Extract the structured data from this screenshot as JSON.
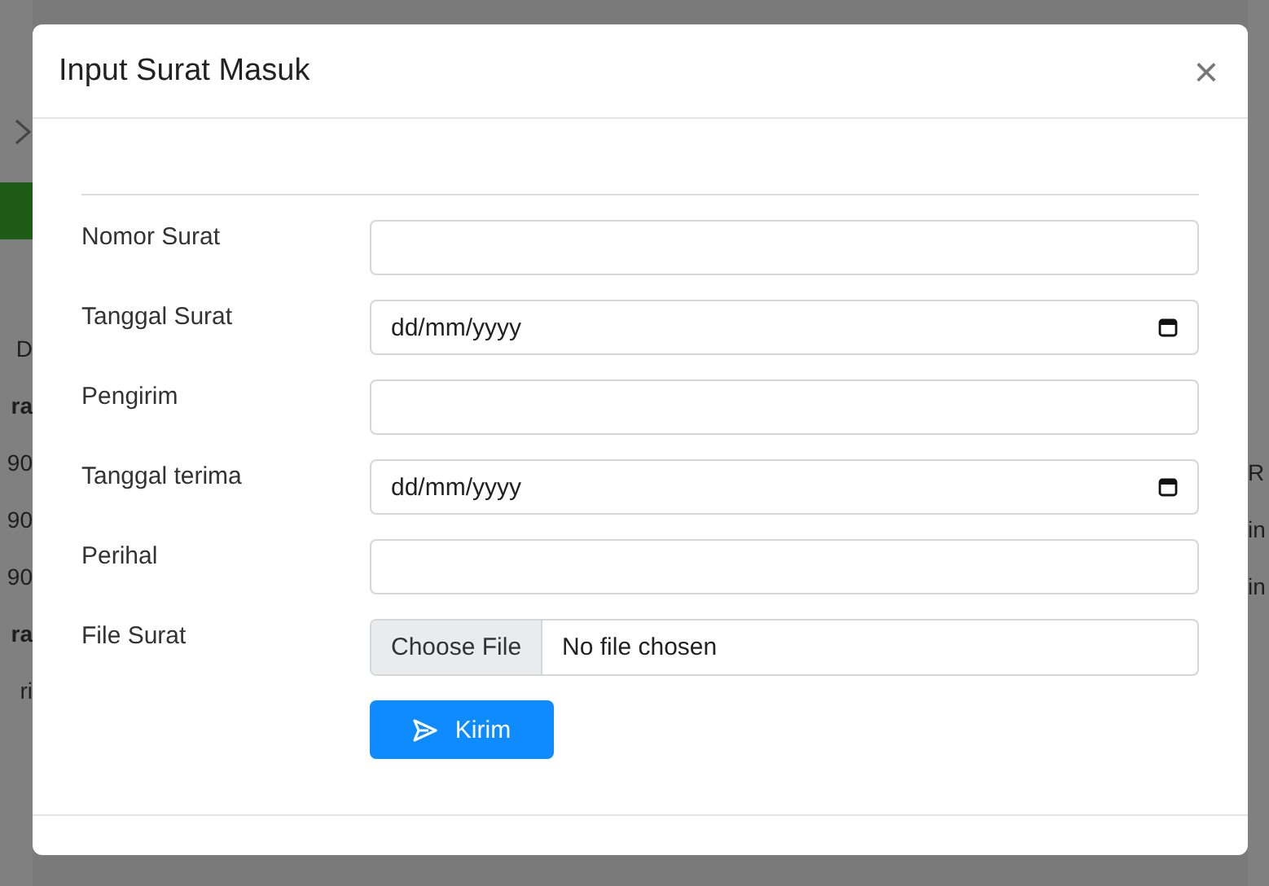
{
  "backdrop": {
    "left_fragments": [
      {
        "text": "D",
        "bold": false
      },
      {
        "text": "ra",
        "bold": true
      },
      {
        "text": "90",
        "bold": false
      },
      {
        "text": "90",
        "bold": false
      },
      {
        "text": "90",
        "bold": false
      },
      {
        "text": "ra",
        "bold": true
      },
      {
        "text": "ri",
        "bold": false
      }
    ],
    "right_fragments": [
      {
        "text": "R"
      },
      {
        "text": "in"
      },
      {
        "text": "in"
      }
    ]
  },
  "modal": {
    "title": "Input Surat Masuk",
    "close": "×",
    "fields": [
      {
        "label": "Nomor Surat",
        "kind": "text"
      },
      {
        "label": "Tanggal Surat",
        "kind": "date",
        "placeholder": "dd/mm/yyyy"
      },
      {
        "label": "Pengirim",
        "kind": "text"
      },
      {
        "label": "Tanggal terima",
        "kind": "date",
        "placeholder": "dd/mm/yyyy"
      },
      {
        "label": "Perihal",
        "kind": "text"
      },
      {
        "label": "File Surat",
        "kind": "file",
        "button": "Choose File",
        "status": "No file chosen"
      }
    ],
    "submit": "Kirim"
  }
}
